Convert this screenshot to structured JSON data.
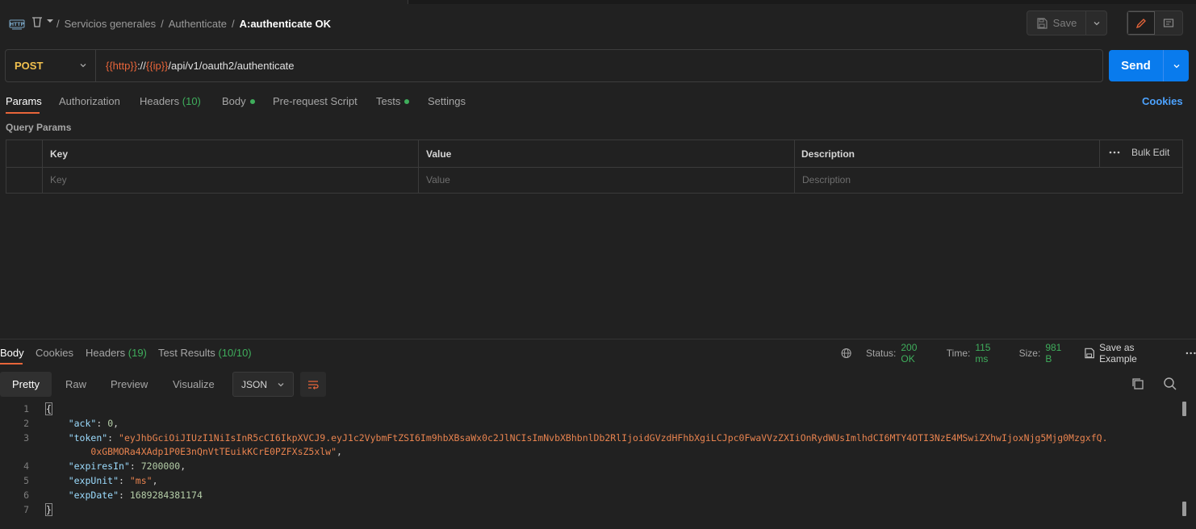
{
  "header": {
    "breadcrumb": [
      "Servicios generales",
      "Authenticate"
    ],
    "current": "A:authenticate OK",
    "save_label": "Save"
  },
  "request": {
    "method": "POST",
    "url_parts": {
      "http_var": "{{http}}",
      "sep": "://",
      "ip_var": "{{ip}}",
      "path": "/api/v1/oauth2/authenticate"
    },
    "send_label": "Send"
  },
  "req_tabs": {
    "params": "Params",
    "authorization": "Authorization",
    "headers": "Headers",
    "headers_count": "(10)",
    "body": "Body",
    "prerequest": "Pre-request Script",
    "tests": "Tests",
    "settings": "Settings",
    "cookies": "Cookies"
  },
  "query_params": {
    "title": "Query Params",
    "columns": {
      "key": "Key",
      "value": "Value",
      "description": "Description"
    },
    "placeholders": {
      "key": "Key",
      "value": "Value",
      "description": "Description"
    },
    "bulk_edit": "Bulk Edit"
  },
  "response": {
    "tabs": {
      "body": "Body",
      "cookies": "Cookies",
      "headers": "Headers",
      "headers_count": "(19)",
      "test_results": "Test Results",
      "test_count": "(10/10)"
    },
    "status_label": "Status:",
    "status_value": "200 OK",
    "time_label": "Time:",
    "time_value": "115 ms",
    "size_label": "Size:",
    "size_value": "981 B",
    "save_example": "Save as Example",
    "views": {
      "pretty": "Pretty",
      "raw": "Raw",
      "preview": "Preview",
      "visualize": "Visualize"
    },
    "format": "JSON",
    "body_lines": {
      "ack_key": "\"ack\"",
      "ack_val": "0",
      "token_key": "\"token\"",
      "token_val_1": "\"eyJhbGciOiJIUzI1NiIsInR5cCI6IkpXVCJ9.eyJ1c2VybmFtZSI6Im9hbXBsaWx0c2JlNCIsImNvbXBhbnlDb2RlIjoidGVzdHFhbXgiLCJpc0FwaVVzZXIiOnRydWUsImlhdCI6MTY4OTI3NzE4MSwiZXhwIjoxNjg5Mjg0MzgxfQ.",
      "token_val_2": "0xGBMORa4XAdp1P0E3nQnVtTEuikKCrE0PZFXsZ5xlw\"",
      "expires_key": "\"expiresIn\"",
      "expires_val": "7200000",
      "unit_key": "\"expUnit\"",
      "unit_val": "\"ms\"",
      "date_key": "\"expDate\"",
      "date_val": "1689284381174"
    }
  },
  "colors": {
    "accent": "#e8653a",
    "send": "#097bed",
    "ok": "#3fae5c",
    "method": "#f2c14e",
    "link": "#4da3ff"
  }
}
